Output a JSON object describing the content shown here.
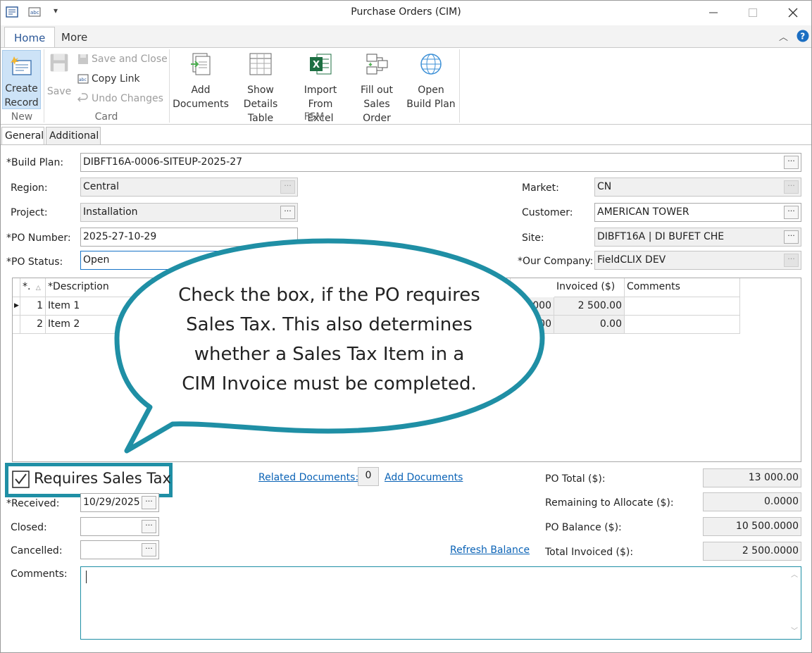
{
  "window": {
    "title": "Purchase Orders (CIM)"
  },
  "ribbon": {
    "tabs": [
      "Home",
      "More"
    ],
    "new_group": {
      "label": "New",
      "create_record": "Create Record"
    },
    "card_group": {
      "label": "Card",
      "save": "Save",
      "save_and_close": "Save and Close",
      "copy_link": "Copy Link",
      "undo_changes": "Undo Changes"
    },
    "fsm_group": {
      "label": "FSM",
      "add_documents": "Add Documents",
      "show_details_table": "Show Details Table",
      "import_from_excel": "Import From Excel",
      "fill_out_sales_order": "Fill out Sales Order",
      "open_build_plan": "Open Build Plan"
    }
  },
  "content_tabs": [
    "General",
    "Additional"
  ],
  "form": {
    "build_plan": {
      "label": "*Build Plan:",
      "value": "DIBFT16A-0006-SITEUP-2025-27"
    },
    "region": {
      "label": "Region:",
      "value": "Central"
    },
    "project": {
      "label": "Project:",
      "value": "Installation"
    },
    "po_number": {
      "label": "*PO Number:",
      "value": "2025-27-10-29"
    },
    "po_status": {
      "label": "*PO Status:",
      "value": "Open"
    },
    "market": {
      "label": "Market:",
      "value": "CN"
    },
    "customer": {
      "label": "Customer:",
      "value": "AMERICAN TOWER"
    },
    "site": {
      "label": "Site:",
      "value": "DIBFT16A | DI BUFET CHE"
    },
    "our_company": {
      "label": "*Our Company:",
      "value": "FieldCLIX DEV"
    }
  },
  "grid": {
    "columns": [
      "*.",
      "*Description",
      "Invoiced ($)",
      "Comments"
    ],
    "rows": [
      {
        "num": "1",
        "description": "Item 1",
        "partial": "000",
        "invoiced": "2 500.00",
        "comments": ""
      },
      {
        "num": "2",
        "description": "Item 2",
        "partial": "00",
        "invoiced": "0.00",
        "comments": ""
      }
    ]
  },
  "callout": {
    "lines": [
      "Check the box, if the PO requires",
      "Sales Tax. This also determines",
      "whether a Sales Tax Item in a",
      "CIM Invoice must be completed."
    ]
  },
  "requires_sales_tax": {
    "label": "Requires Sales Tax",
    "checked": true
  },
  "related_documents": {
    "label": "Related Documents:",
    "count": "0",
    "add_link": "Add Documents"
  },
  "dates": {
    "received": {
      "label": "*Received:",
      "value": "10/29/2025"
    },
    "closed": {
      "label": "Closed:",
      "value": ""
    },
    "cancelled": {
      "label": "Cancelled:",
      "value": ""
    }
  },
  "refresh_balance": "Refresh Balance",
  "totals": {
    "po_total": {
      "label": "PO Total ($):",
      "value": "13 000.00"
    },
    "remaining": {
      "label": "Remaining to Allocate ($):",
      "value": "0.0000"
    },
    "po_balance": {
      "label": "PO Balance ($):",
      "value": "10 500.0000"
    },
    "total_invoiced": {
      "label": "Total Invoiced ($):",
      "value": "2 500.0000"
    }
  },
  "comments": {
    "label": "Comments:",
    "value": ""
  },
  "colors": {
    "accent": "#1f8fa5",
    "link": "#0b63b6",
    "tab_active": "#2b5797"
  }
}
